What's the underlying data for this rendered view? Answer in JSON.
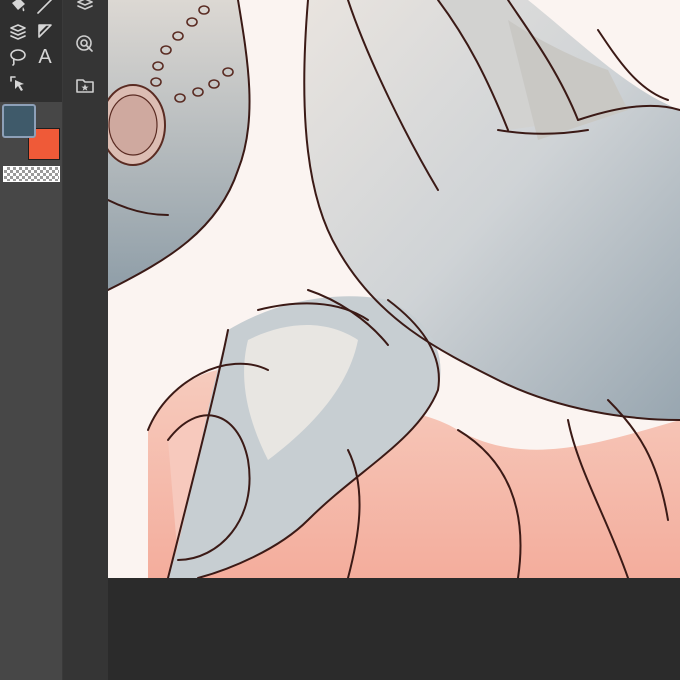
{
  "tools": {
    "text_tool_glyph": "A"
  },
  "colors": {
    "main_color": "#3f5a6a",
    "sub_color": "#ef5a38",
    "panel_bg": "#474747",
    "canvas_bg": "#fbf4f1"
  },
  "icons": [
    "fill-bucket-icon",
    "pen-line-icon",
    "layer-stack-icon",
    "gradient-icon",
    "lasso-icon",
    "text-icon",
    "select-move-icon",
    "layers-icon",
    "zoom-icon",
    "material-folder-icon"
  ]
}
